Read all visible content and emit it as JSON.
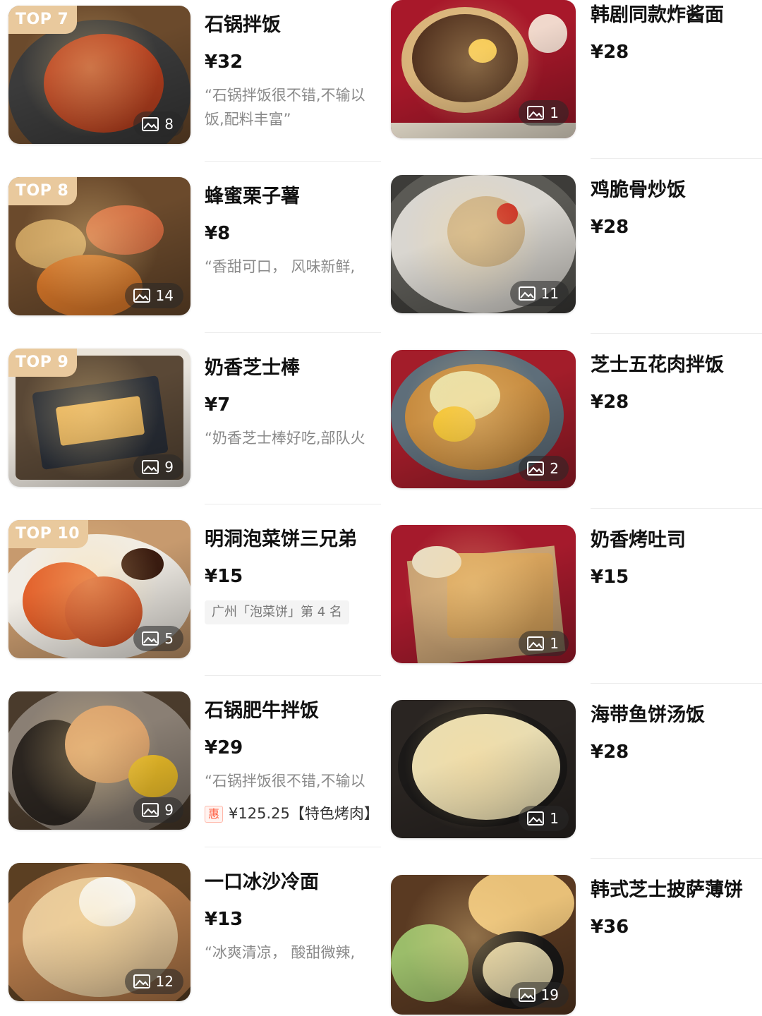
{
  "left": [
    {
      "rank": "TOP 7",
      "name": "石锅拌饭",
      "price": "¥32",
      "review": "“石锅拌饭很不错,不输以饭,配料丰富”",
      "photos": "8",
      "colors": [
        "#3b3b3b",
        "#b8401f"
      ]
    },
    {
      "rank": "TOP 8",
      "name": "蜂蜜栗子薯",
      "price": "¥8",
      "review": "“香甜可口， 风味新鲜,",
      "photos": "14",
      "colors": [
        "#7a5a3a",
        "#d9782a"
      ]
    },
    {
      "rank": "TOP 9",
      "name": "奶香芝士棒",
      "price": "¥7",
      "review": "“奶香芝士棒好吃,部队火",
      "photos": "9",
      "colors": [
        "#5a4836",
        "#e6b35c"
      ]
    },
    {
      "rank": "TOP 10",
      "name": "明洞泡菜饼三兄弟",
      "price": "¥15",
      "rank_tag": "广州「泡菜饼」第 4 名",
      "photos": "5",
      "colors": [
        "#c79a6e",
        "#e2602b"
      ]
    },
    {
      "name": "石锅肥牛拌饭",
      "price": "¥29",
      "review": "“石锅拌饭很不错,不输以",
      "promo_badge": "惠",
      "promo_text": "¥125.25【特色烤肉】",
      "photos": "9",
      "colors": [
        "#4a3b2c",
        "#d9a06b"
      ]
    },
    {
      "name": "一口冰沙冷面",
      "price": "¥13",
      "review": "“冰爽清凉， 酸甜微辣,",
      "photos": "12",
      "colors": [
        "#5b3f22",
        "#e7c99b"
      ]
    }
  ],
  "right": [
    {
      "name": "韩剧同款炸酱面",
      "price": "¥28",
      "photos": "1",
      "colors": [
        "#a8182a",
        "#4b2b1a"
      ]
    },
    {
      "name": "鸡脆骨炒饭",
      "price": "¥28",
      "photos": "11",
      "colors": [
        "#5b5a55",
        "#c9b08a"
      ]
    },
    {
      "name": "芝士五花肉拌饭",
      "price": "¥28",
      "photos": "2",
      "colors": [
        "#a31d2a",
        "#5e6e7a"
      ]
    },
    {
      "name": "奶香烤吐司",
      "price": "¥15",
      "photos": "1",
      "colors": [
        "#a51a2c",
        "#d7a35c"
      ]
    },
    {
      "name": "海带鱼饼汤饭",
      "price": "¥28",
      "photos": "1",
      "colors": [
        "#2a2522",
        "#e9ddb2"
      ]
    },
    {
      "name": "韩式芝士披萨薄饼",
      "price": "¥36",
      "photos": "19",
      "colors": [
        "#5a3a22",
        "#e8c078"
      ]
    }
  ]
}
